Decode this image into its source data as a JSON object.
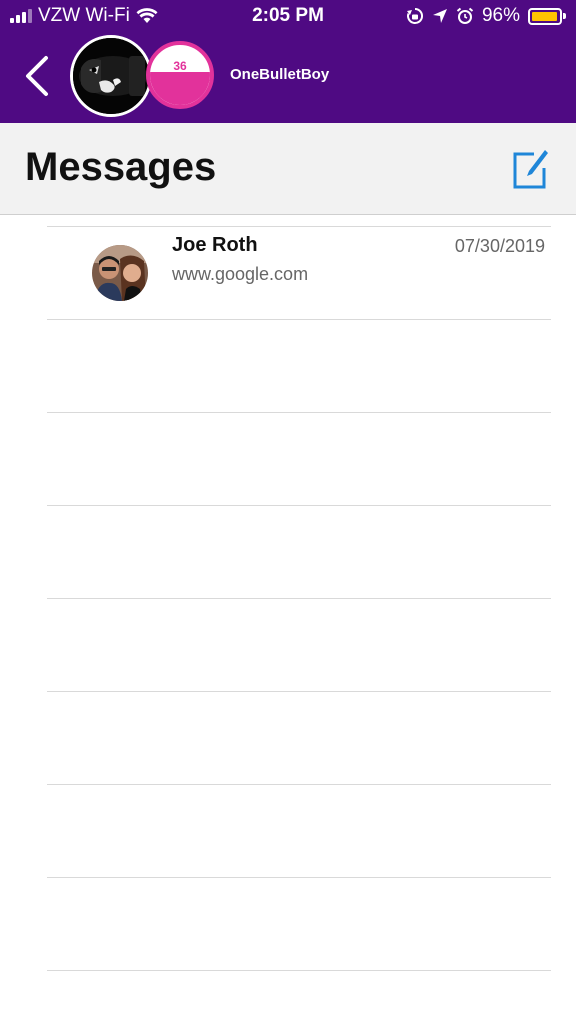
{
  "status_bar": {
    "carrier": "VZW Wi-Fi",
    "time": "2:05 PM",
    "battery_percent": "96%",
    "battery_level": 0.96,
    "icons": [
      "signal-icon",
      "wifi-icon",
      "rotation-lock-icon",
      "location-icon",
      "alarm-icon",
      "battery-icon"
    ]
  },
  "header": {
    "back_icon": "chevron-left-icon",
    "username": "OneBulletBoy",
    "level": "36",
    "level_fill": 0.55
  },
  "title_bar": {
    "title": "Messages",
    "compose_icon": "compose-icon"
  },
  "conversations": [
    {
      "name": "Joe Roth",
      "preview": "www.google.com",
      "date": "07/30/2019"
    }
  ],
  "colors": {
    "header_bg": "#4f0a83",
    "accent_pink": "#e2329b",
    "compose_blue": "#1f86d8",
    "battery_yellow": "#ffc400"
  }
}
